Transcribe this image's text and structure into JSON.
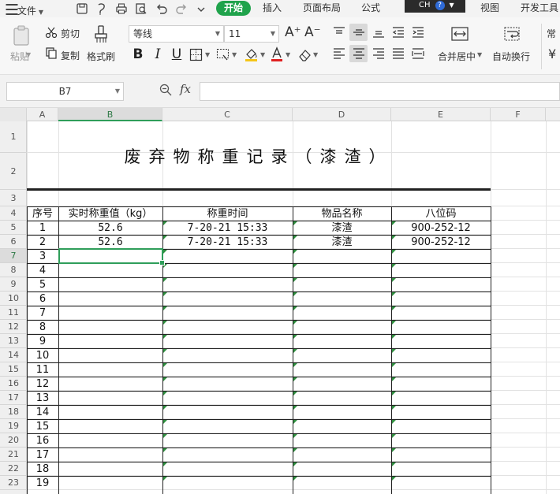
{
  "menubar": {
    "file_label": "文件",
    "tabs": [
      "开始",
      "插入",
      "页面布局",
      "公式",
      "视图",
      "开发工具"
    ],
    "ime_label": "CH",
    "ime_help": "?",
    "quick_access_icons": [
      "save-icon",
      "format-painter-icon",
      "print-icon",
      "print-preview-icon",
      "undo-icon",
      "redo-icon",
      "customize-icon"
    ]
  },
  "ribbon": {
    "paste_label": "粘贴",
    "cut_label": "剪切",
    "copy_label": "复制",
    "format_painter_label": "格式刷",
    "font_name": "等线",
    "font_size": "11",
    "font_grow": "A⁺",
    "font_shrink": "A⁻",
    "bold": "B",
    "italic": "I",
    "underline": "U",
    "merge_label": "合并居中",
    "wrap_label": "自动换行",
    "right_edge_label": "常",
    "right_edge_char": "¥",
    "accent_color": "#20a34c",
    "font_color": "#e02020",
    "fill_color": "#f5c518"
  },
  "formula_bar": {
    "cell_reference": "B7",
    "fx_label": "fx",
    "formula_value": ""
  },
  "sheet": {
    "column_letters": [
      "A",
      "B",
      "C",
      "D",
      "E",
      "F"
    ],
    "selected_column": "B",
    "selected_row": "7",
    "title": "废弃物称重记录（漆渣）",
    "row_numbers": [
      "1",
      "2",
      "3",
      "4",
      "5",
      "6",
      "7",
      "8",
      "9",
      "10",
      "11",
      "12",
      "13",
      "14",
      "15",
      "16",
      "17",
      "18",
      "19",
      "20",
      "21",
      "22",
      "23"
    ],
    "headers": [
      "序号",
      "实时称重值（kg）",
      "称重时间",
      "物品名称",
      "八位码"
    ],
    "rows": [
      [
        "1",
        "52.6",
        "7-20-21 15:33",
        "漆渣",
        "900-252-12"
      ],
      [
        "2",
        "52.6",
        "7-20-21 15:33",
        "漆渣",
        "900-252-12"
      ],
      [
        "3",
        "",
        "",
        "",
        ""
      ],
      [
        "4",
        "",
        "",
        "",
        ""
      ],
      [
        "5",
        "",
        "",
        "",
        ""
      ],
      [
        "6",
        "",
        "",
        "",
        ""
      ],
      [
        "7",
        "",
        "",
        "",
        ""
      ],
      [
        "8",
        "",
        "",
        "",
        ""
      ],
      [
        "9",
        "",
        "",
        "",
        ""
      ],
      [
        "10",
        "",
        "",
        "",
        ""
      ],
      [
        "11",
        "",
        "",
        "",
        ""
      ],
      [
        "12",
        "",
        "",
        "",
        ""
      ],
      [
        "13",
        "",
        "",
        "",
        ""
      ],
      [
        "14",
        "",
        "",
        "",
        ""
      ],
      [
        "15",
        "",
        "",
        "",
        ""
      ],
      [
        "16",
        "",
        "",
        "",
        ""
      ],
      [
        "17",
        "",
        "",
        "",
        ""
      ],
      [
        "18",
        "",
        "",
        "",
        ""
      ],
      [
        "19",
        "",
        "",
        "",
        ""
      ]
    ]
  }
}
